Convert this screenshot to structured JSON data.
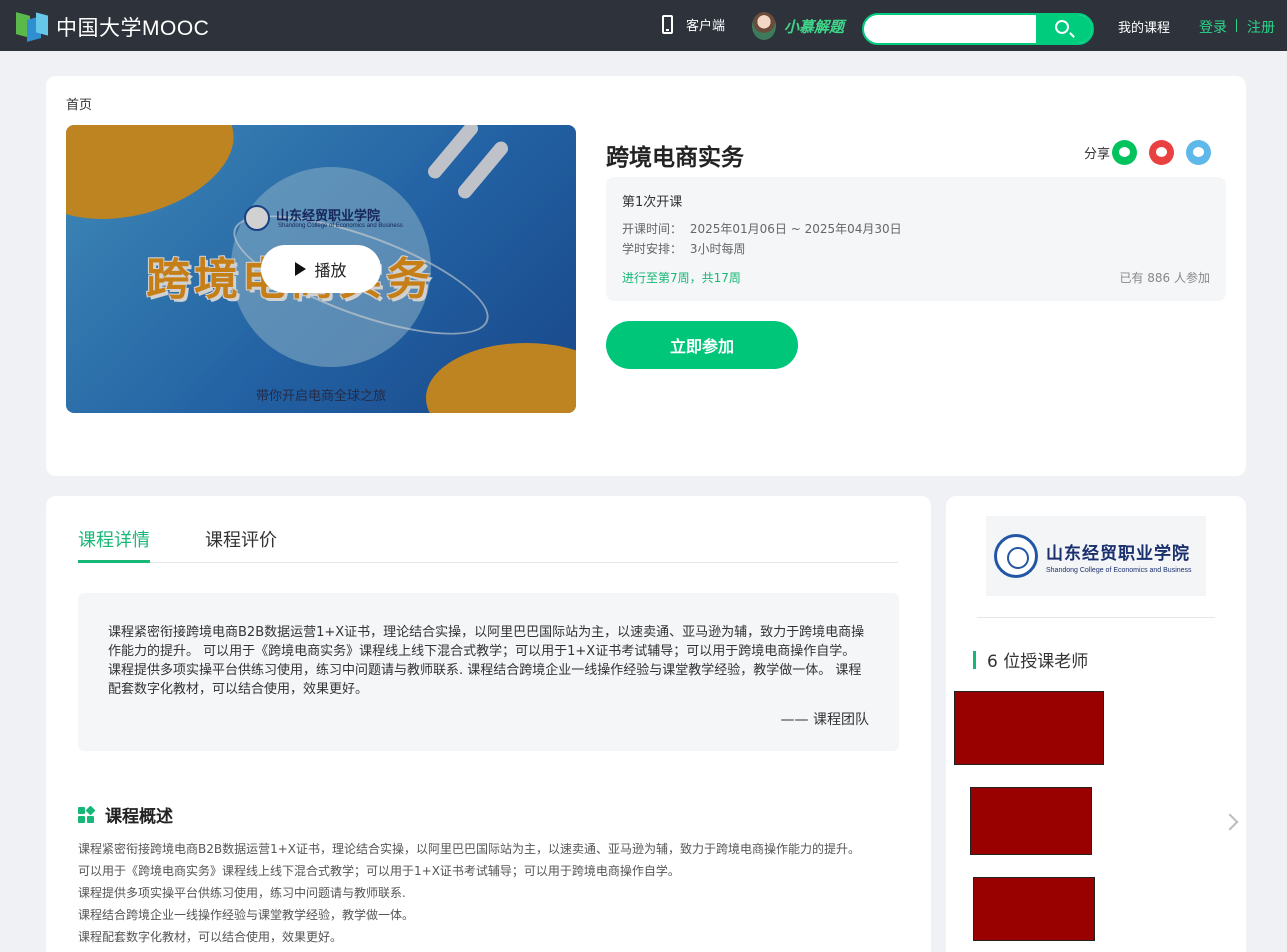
{
  "nav": {
    "logo_text": "中国大学MOOC",
    "client_label": "客户端",
    "helper_label": "小慕解题",
    "search_placeholder": "",
    "my_courses": "我的课程",
    "login": "登录",
    "register": "注册"
  },
  "breadcrumb": "首页",
  "cover": {
    "school_name": "山东经贸职业学院",
    "school_name_en": "Shandong College of Economics and Business",
    "title_art": "跨境电商实务",
    "subline": "带你开启电商全球之旅",
    "play_label": "播放"
  },
  "course": {
    "title": "跨境电商实务",
    "share_label": "分享",
    "term": "第1次开课",
    "time_label": "开课时间：",
    "time_value": "2025年01月06日 ~ 2025年04月30日",
    "hours_label": "学时安排：",
    "hours_value": "3小时每周",
    "progress": "进行至第7周，共17周",
    "enrolled": "已有 886 人参加",
    "join_button": "立即参加"
  },
  "tabs": [
    "课程详情",
    "课程评价"
  ],
  "quote": {
    "text": "课程紧密衔接跨境电商B2B数据运营1+X证书，理论结合实操，以阿里巴巴国际站为主，以速卖通、亚马逊为辅，致力于跨境电商操作能力的提升。 可以用于《跨境电商实务》课程线上线下混合式教学；可以用于1+X证书考试辅导；可以用于跨境电商操作自学。 课程提供多项实操平台供练习使用，练习中问题请与教师联系. 课程结合跨境企业一线操作经验与课堂教学经验，教学做一体。 课程配套数字化教材，可以结合使用，效果更好。",
    "author": "—— 课程团队"
  },
  "overview": {
    "title": "课程概述",
    "lines": [
      "课程紧密衔接跨境电商B2B数据运营1+X证书，理论结合实操，以阿里巴巴国际站为主，以速卖通、亚马逊为辅，致力于跨境电商操作能力的提升。",
      "可以用于《跨境电商实务》课程线上线下混合式教学；可以用于1+X证书考试辅导；可以用于跨境电商操作自学。",
      "课程提供多项实操平台供练习使用，练习中问题请与教师联系.",
      "课程结合跨境企业一线操作经验与课堂教学经验，教学做一体。",
      "课程配套数字化教材，可以结合使用，效果更好。"
    ]
  },
  "side": {
    "school_cn": "山东经贸职业学院",
    "school_en": "Shandong College of Economics and Business",
    "teacher_heading": "6 位授课老师"
  },
  "colors": {
    "brand_green": "#00c67a",
    "nav_bg": "#2d323b",
    "redaction": "#990000"
  }
}
